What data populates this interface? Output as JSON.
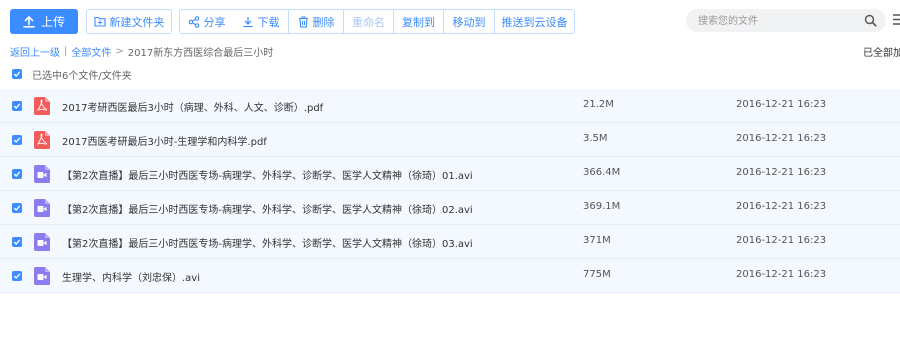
{
  "toolbar": {
    "upload_label": "上传",
    "new_folder_label": "新建文件夹",
    "share_label": "分享",
    "download_label": "下载",
    "delete_label": "删除",
    "rename_label": "重命名",
    "copy_to_label": "复制到",
    "move_to_label": "移动到",
    "push_label": "推送到云设备"
  },
  "search": {
    "placeholder": "搜索您的文件",
    "value": ""
  },
  "breadcrumb": {
    "back": "返回上一级",
    "sep1": "|",
    "all_files": "全部文件",
    "sep2": ">",
    "current": "2017新东方西医综合最后三小时"
  },
  "status": {
    "loaded_all": "已全部加"
  },
  "selection": {
    "label": "已选中6个文件/文件夹"
  },
  "files": [
    {
      "name": "2017考研西医最后3小时（病理、外科、人文、诊断）.pdf",
      "size": "21.2M",
      "modified": "2016-12-21 16:23",
      "type": "pdf-icon",
      "selected": true
    },
    {
      "name": "2017西医考研最后3小时-生理学和内科学.pdf",
      "size": "3.5M",
      "modified": "2016-12-21 16:23",
      "type": "pdf-icon",
      "selected": true
    },
    {
      "name": "【第2次直播】最后三小时西医专场-病理学、外科学、诊断学、医学人文精神（徐琦）01.avi",
      "size": "366.4M",
      "modified": "2016-12-21 16:23",
      "type": "video-icon",
      "selected": true
    },
    {
      "name": "【第2次直播】最后三小时西医专场-病理学、外科学、诊断学、医学人文精神（徐琦）02.avi",
      "size": "369.1M",
      "modified": "2016-12-21 16:23",
      "type": "video-icon",
      "selected": true
    },
    {
      "name": "【第2次直播】最后三小时西医专场-病理学、外科学、诊断学、医学人文精神（徐琦）03.avi",
      "size": "371M",
      "modified": "2016-12-21 16:23",
      "type": "video-icon",
      "selected": true
    },
    {
      "name": "生理学、内科学（刘忠保）.avi",
      "size": "775M",
      "modified": "2016-12-21 16:23",
      "type": "video-icon",
      "selected": true
    }
  ],
  "colors": {
    "accent": "#3b8cff",
    "pdf": "#f45b5b",
    "video": "#8c7cf0",
    "row_selected": "#f4f8ff"
  }
}
